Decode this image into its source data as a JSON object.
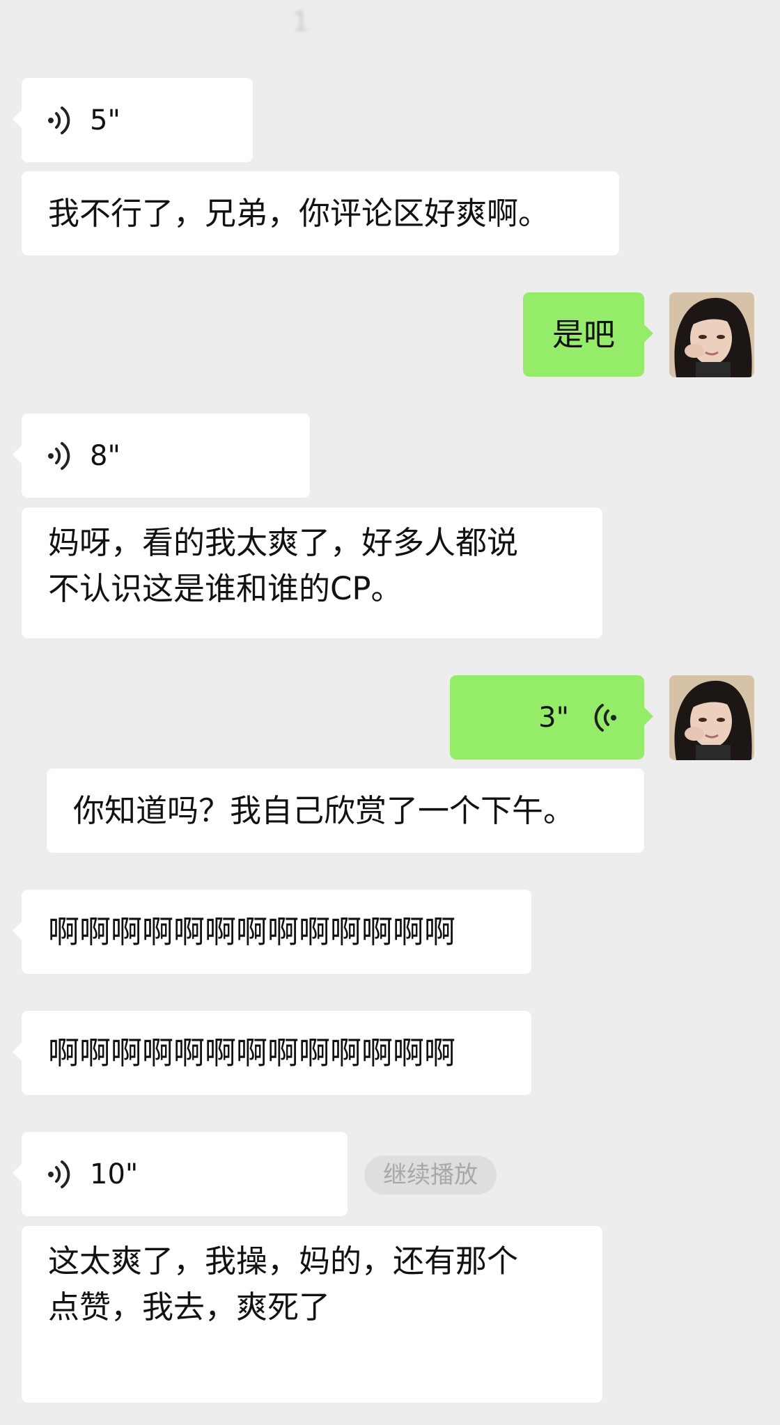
{
  "header": {
    "title": "1"
  },
  "messages": {
    "m1_voice": {
      "duration": "5\""
    },
    "m2_text": "我不行了，兄弟，你评论区好爽啊。",
    "m3_text": "是吧",
    "m4_voice": {
      "duration": "8\""
    },
    "m5_line1": "妈呀，看的我太爽了，好多人都说",
    "m5_line2": "不认识这是谁和谁的CP。",
    "m6_voice": {
      "duration": "3\""
    },
    "m7_text": "你知道吗？我自己欣赏了一个下午。",
    "m8_text": "啊啊啊啊啊啊啊啊啊啊啊啊啊",
    "m9_text": "啊啊啊啊啊啊啊啊啊啊啊啊啊",
    "m10_voice": {
      "duration": "10\"",
      "continue_label": "继续播放"
    },
    "m11_line1": "这太爽了，我操，妈的，还有那个",
    "m11_line2": "点赞，我去，爽死了"
  },
  "colors": {
    "background": "#ededed",
    "incoming_bubble": "#ffffff",
    "outgoing_bubble": "#95ec69"
  },
  "icons": {
    "voice": "voice-wave-icon",
    "avatar": "avatar-girl-icon"
  }
}
